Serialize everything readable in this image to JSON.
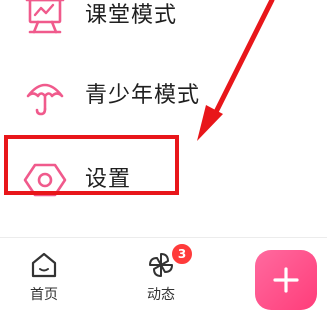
{
  "menu": {
    "items": [
      {
        "label": "课堂模式",
        "icon": "classroom-board-icon"
      },
      {
        "label": "青少年模式",
        "icon": "umbrella-icon"
      },
      {
        "label": "设置",
        "icon": "settings-hexagon-icon"
      }
    ]
  },
  "annotation": {
    "highlight_color": "#e8161a",
    "target": "settings"
  },
  "bottom_nav": {
    "home": {
      "label": "首页",
      "icon": "home-icon"
    },
    "moments": {
      "label": "动态",
      "icon": "pinwheel-icon",
      "badge": "3"
    },
    "add": {
      "icon": "plus-icon"
    }
  },
  "colors": {
    "accent_pink": "#f05a8c",
    "badge_red": "#ff3b3b",
    "fab_pink": "#ff4f86"
  }
}
